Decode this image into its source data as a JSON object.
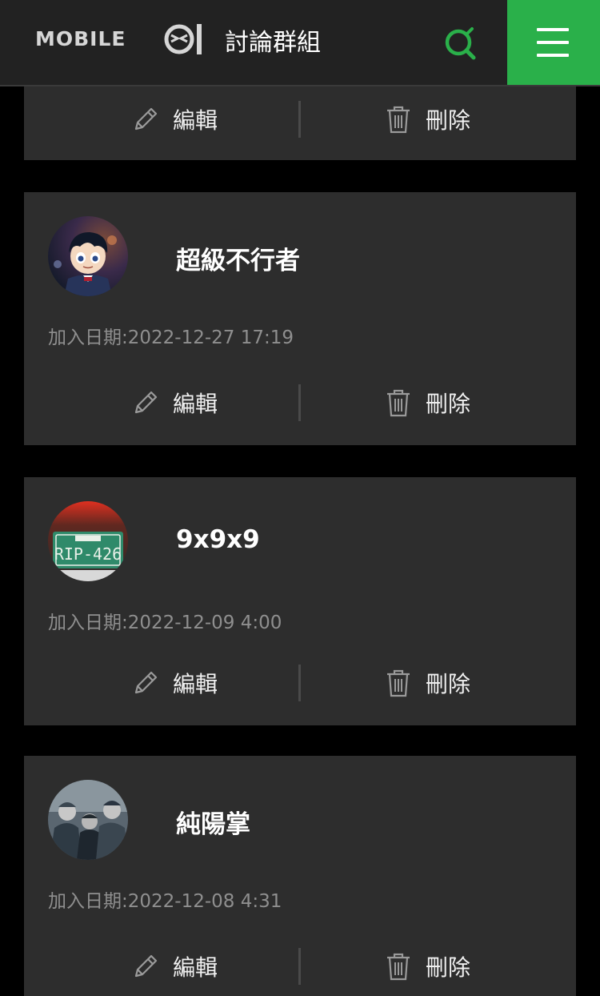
{
  "header": {
    "logo_text": "MOBILE",
    "logo_suffix": "01",
    "title": "討論群組"
  },
  "colors": {
    "accent": "#2ab04a",
    "card_bg": "#2d2d2d",
    "header_bg": "#222222",
    "date_text": "#8f8f8f"
  },
  "actions": {
    "edit_label": "編輯",
    "delete_label": "刪除"
  },
  "members": [
    {
      "name": "超級不行者",
      "join_date": "加入日期:2022-12-27 17:19"
    },
    {
      "name": "9x9x9",
      "join_date": "加入日期:2022-12-09 4:00"
    },
    {
      "name": "純陽掌",
      "join_date": "加入日期:2022-12-08 4:31"
    }
  ]
}
